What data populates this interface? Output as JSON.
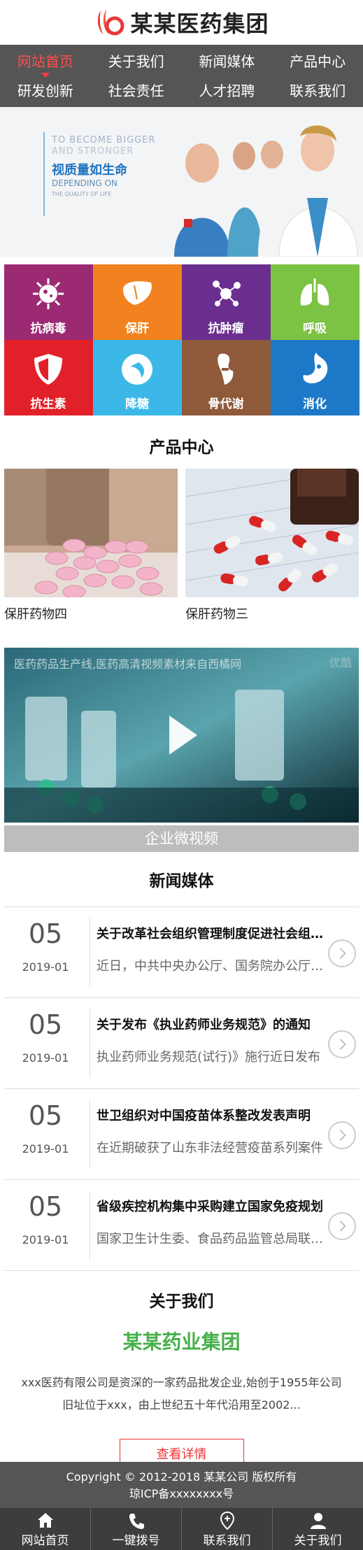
{
  "header": {
    "logo_text": "某某医药集团"
  },
  "nav": {
    "rows": [
      [
        {
          "label": "网站首页",
          "active": true
        },
        {
          "label": "关于我们"
        },
        {
          "label": "新闻媒体"
        },
        {
          "label": "产品中心"
        }
      ],
      [
        {
          "label": "研发创新"
        },
        {
          "label": "社会责任"
        },
        {
          "label": "人才招聘"
        },
        {
          "label": "联系我们"
        }
      ]
    ]
  },
  "banner": {
    "en_line1": "TO BECOME BIGGER",
    "en_line2": "AND STRONGER",
    "cn_slogan": "视质量如生命",
    "en_line3": "DEPENDING ON",
    "en_line4": "THE QUALITY OF LIFE"
  },
  "categories": [
    {
      "label": "抗病毒",
      "color": "#9b2a72",
      "icon": "virus-icon"
    },
    {
      "label": "保肝",
      "color": "#f1821f",
      "icon": "liver-icon"
    },
    {
      "label": "抗肿瘤",
      "color": "#6a2f8e",
      "icon": "molecule-icon"
    },
    {
      "label": "呼吸",
      "color": "#7cc243",
      "icon": "lungs-icon"
    },
    {
      "label": "抗生素",
      "color": "#e2202a",
      "icon": "shield-icon"
    },
    {
      "label": "降糖",
      "color": "#3cb8e8",
      "icon": "drop-icon"
    },
    {
      "label": "骨代谢",
      "color": "#8e5a3a",
      "icon": "bone-icon"
    },
    {
      "label": "消化",
      "color": "#1e78c8",
      "icon": "stomach-icon"
    }
  ],
  "products_section": {
    "title": "产品中心",
    "items": [
      {
        "name": "保肝药物四"
      },
      {
        "name": "保肝药物三"
      }
    ]
  },
  "video": {
    "title": "医药药品生产线,医药高清视频素材来自西橘网",
    "watermark": "优酷",
    "caption": "企业微视频"
  },
  "news_section": {
    "title": "新闻媒体",
    "items": [
      {
        "day": "05",
        "date": "2019-01",
        "title": "关于改革社会组织管理制度促进社会组织健康有序发展的意见",
        "summary": "近日，中共中央办公厅、国务院办公厅印发了相关意见"
      },
      {
        "day": "05",
        "date": "2019-01",
        "title": "关于发布《执业药师业务规范》的通知",
        "summary": "执业药师业务规范(试行)》施行近日发布"
      },
      {
        "day": "05",
        "date": "2019-01",
        "title": "世卫组织对中国疫苗体系整改发表声明",
        "summary": "在近期破获了山东非法经营疫苗系列案件"
      },
      {
        "day": "05",
        "date": "2019-01",
        "title": "省级疾控机构集中采购建立国家免疫规划",
        "summary": "国家卫生计生委、食品药品监管总局联合印发"
      }
    ]
  },
  "about": {
    "title": "关于我们",
    "company": "某某药业集团",
    "text_line1": "xxx医药有限公司是资深的一家药品批发企业,始创于1955年公司",
    "text_line2": "旧址位于xxx，由上世纪五十年代沿用至2002...",
    "button": "查看详情"
  },
  "footer": {
    "copyright": "Copyright © 2012-2018 某某公司 版权所有",
    "icp": "琼ICP备xxxxxxxx号"
  },
  "bottom_bar": [
    {
      "label": "网站首页",
      "icon": "home-icon"
    },
    {
      "label": "一键拨号",
      "icon": "phone-icon"
    },
    {
      "label": "联系我们",
      "icon": "location-icon"
    },
    {
      "label": "关于我们",
      "icon": "user-icon"
    }
  ]
}
